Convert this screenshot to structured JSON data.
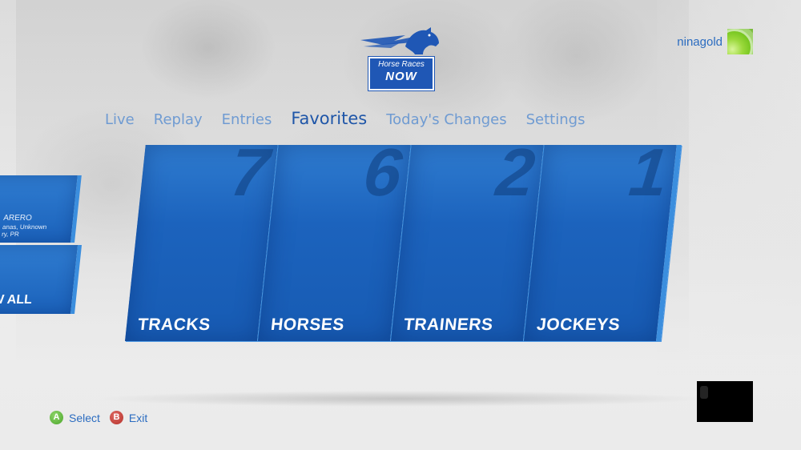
{
  "logo": {
    "line1": "Horse Races",
    "line2": "NOW",
    "icon": "horse-head-icon"
  },
  "user": {
    "name": "ninagold",
    "avatar_icon": "gamerpic-icon"
  },
  "nav": {
    "items": [
      {
        "label": "Live",
        "active": false
      },
      {
        "label": "Replay",
        "active": false
      },
      {
        "label": "Entries",
        "active": false
      },
      {
        "label": "Favorites",
        "active": true
      },
      {
        "label": "Today's Changes",
        "active": false
      },
      {
        "label": "Settings",
        "active": false
      }
    ]
  },
  "tiles": [
    {
      "label": "TRACKS",
      "count": "7"
    },
    {
      "label": "HORSES",
      "count": "6"
    },
    {
      "label": "TRAINERS",
      "count": "2"
    },
    {
      "label": "JOCKEYS",
      "count": "1"
    }
  ],
  "left_panel": {
    "line1": "ARERO",
    "line2": "anas, Unknown",
    "line3": "ry, PR",
    "view_all": "W ALL"
  },
  "hints": [
    {
      "button": "A",
      "label": "Select",
      "color": "#4aa52a"
    },
    {
      "button": "B",
      "label": "Exit",
      "color": "#b3302a"
    }
  ],
  "colors": {
    "accent": "#1f56a8",
    "tile": "#1c63bd",
    "nav_inactive": "#6f9bd2"
  }
}
